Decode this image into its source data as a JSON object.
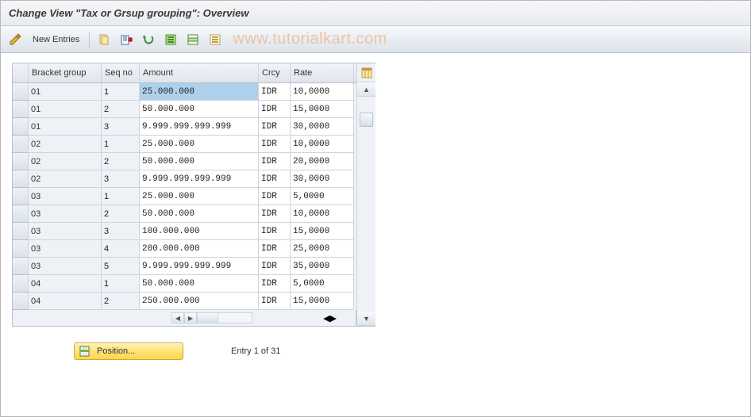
{
  "title": "Change View \"Tax or Grsup grouping\": Overview",
  "toolbar": {
    "new_entries_label": "New Entries"
  },
  "watermark": "www.tutorialkart.com",
  "columns": {
    "bracket_group": "Bracket group",
    "seq_no": "Seq no",
    "amount": "Amount",
    "crcy": "Crcy",
    "rate": "Rate"
  },
  "rows": [
    {
      "bracket_group": "01",
      "seq_no": "1",
      "amount": "25.000.000",
      "crcy": "IDR",
      "rate": "10,0000",
      "selected": true
    },
    {
      "bracket_group": "01",
      "seq_no": "2",
      "amount": "50.000.000",
      "crcy": "IDR",
      "rate": "15,0000"
    },
    {
      "bracket_group": "01",
      "seq_no": "3",
      "amount": "9.999.999.999.999",
      "crcy": "IDR",
      "rate": "30,0000"
    },
    {
      "bracket_group": "02",
      "seq_no": "1",
      "amount": "25.000.000",
      "crcy": "IDR",
      "rate": "10,0000"
    },
    {
      "bracket_group": "02",
      "seq_no": "2",
      "amount": "50.000.000",
      "crcy": "IDR",
      "rate": "20,0000"
    },
    {
      "bracket_group": "02",
      "seq_no": "3",
      "amount": "9.999.999.999.999",
      "crcy": "IDR",
      "rate": "30,0000"
    },
    {
      "bracket_group": "03",
      "seq_no": "1",
      "amount": "25.000.000",
      "crcy": "IDR",
      "rate": "5,0000"
    },
    {
      "bracket_group": "03",
      "seq_no": "2",
      "amount": "50.000.000",
      "crcy": "IDR",
      "rate": "10,0000"
    },
    {
      "bracket_group": "03",
      "seq_no": "3",
      "amount": "100.000.000",
      "crcy": "IDR",
      "rate": "15,0000"
    },
    {
      "bracket_group": "03",
      "seq_no": "4",
      "amount": "200.000.000",
      "crcy": "IDR",
      "rate": "25,0000"
    },
    {
      "bracket_group": "03",
      "seq_no": "5",
      "amount": "9.999.999.999.999",
      "crcy": "IDR",
      "rate": "35,0000"
    },
    {
      "bracket_group": "04",
      "seq_no": "1",
      "amount": "50.000.000",
      "crcy": "IDR",
      "rate": "5,0000"
    },
    {
      "bracket_group": "04",
      "seq_no": "2",
      "amount": "250.000.000",
      "crcy": "IDR",
      "rate": "15,0000"
    }
  ],
  "footer": {
    "position_label": "Position...",
    "entry_text": "Entry 1 of 31"
  }
}
